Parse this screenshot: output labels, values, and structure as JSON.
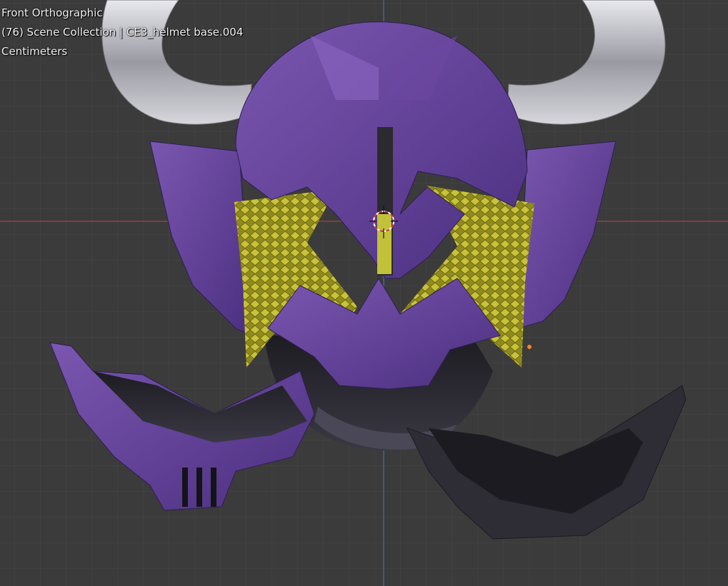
{
  "viewport": {
    "view_name": "Front Orthographic",
    "collection_info": "(76) Scene Collection | CE3_helmet base.004",
    "units": "Centimeters",
    "background": "#3b3b3b",
    "grid_color": "#4a4a4a",
    "x_axis_color": "#a84b3e",
    "z_axis_color": "#3f6db3"
  },
  "model": {
    "name": "CE3_helmet base.004",
    "colors": {
      "purple": "#5c3a94",
      "purple_light": "#7a55ad",
      "purple_dark": "#3e2766",
      "honeycomb_yellow": "#b5b52a",
      "horn_chrome": "#c9c9cf",
      "dark_parts": "#2c2a33"
    }
  },
  "icons": {
    "cursor": "3d-cursor-icon",
    "origin": "object-origin-icon"
  }
}
